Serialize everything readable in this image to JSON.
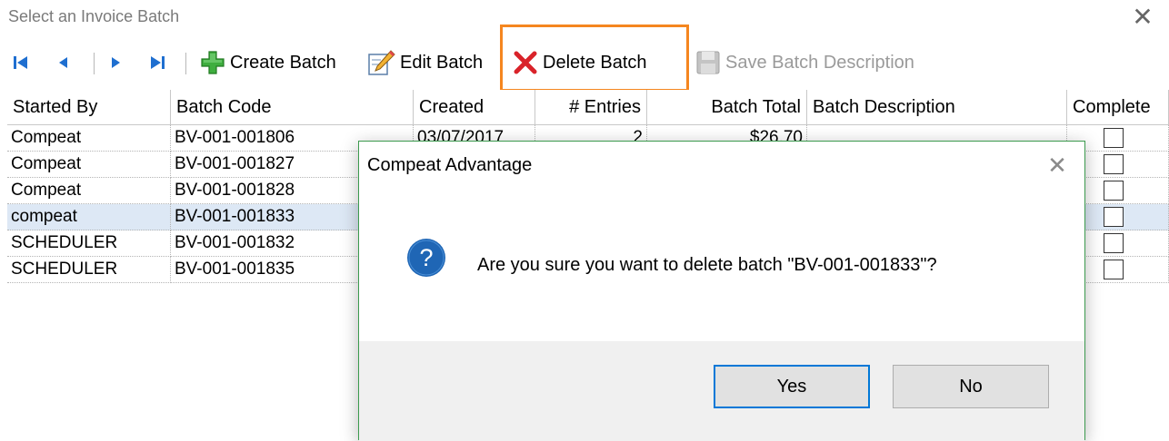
{
  "window": {
    "title": "Select an Invoice Batch",
    "close_glyph": "✕"
  },
  "toolbar": {
    "nav_icons": [
      "first-record-icon",
      "previous-record-icon",
      "next-record-icon",
      "last-record-icon"
    ],
    "create_batch_label": "Create Batch",
    "edit_batch_label": "Edit Batch",
    "delete_batch_label": "Delete Batch",
    "save_description_label": "Save Batch Description",
    "save_description_enabled": false,
    "highlighted_button": "delete-batch-button",
    "highlight_color": "#f5861f",
    "nav_icon_color": "#1f6fd0"
  },
  "grid": {
    "columns": [
      "Started By",
      "Batch Code",
      "Created",
      "# Entries",
      "Batch Total",
      "Batch Description",
      "Complete"
    ],
    "rows": [
      {
        "started_by": "Compeat",
        "batch_code": "BV-001-001806",
        "created": "03/07/2017",
        "entries": "2",
        "total": "$26.70",
        "description": "",
        "complete": false,
        "selected": false
      },
      {
        "started_by": "Compeat",
        "batch_code": "BV-001-001827",
        "created": "",
        "entries": "",
        "total": "",
        "description": "",
        "complete": false,
        "selected": false
      },
      {
        "started_by": "Compeat",
        "batch_code": "BV-001-001828",
        "created": "",
        "entries": "",
        "total": "",
        "description": "",
        "complete": false,
        "selected": false
      },
      {
        "started_by": "compeat",
        "batch_code": "BV-001-001833",
        "created": "",
        "entries": "",
        "total": "",
        "description": "",
        "complete": false,
        "selected": true
      },
      {
        "started_by": "SCHEDULER",
        "batch_code": "BV-001-001832",
        "created": "",
        "entries": "",
        "total": "",
        "description": "",
        "complete": false,
        "selected": false
      },
      {
        "started_by": "SCHEDULER",
        "batch_code": "BV-001-001835",
        "created": "",
        "entries": "",
        "total": "",
        "description": "",
        "complete": false,
        "selected": false
      }
    ],
    "selected_row_color": "#dde8f5"
  },
  "dialog": {
    "title": "Compeat Advantage",
    "close_glyph": "✕",
    "icon": "question-icon",
    "icon_color": "#1f66b5",
    "message": "Are you sure you want to delete batch \"BV-001-001833\"?",
    "yes_label": "Yes",
    "no_label": "No",
    "default_button": "yes-button",
    "border_color": "#3c9a4e"
  }
}
